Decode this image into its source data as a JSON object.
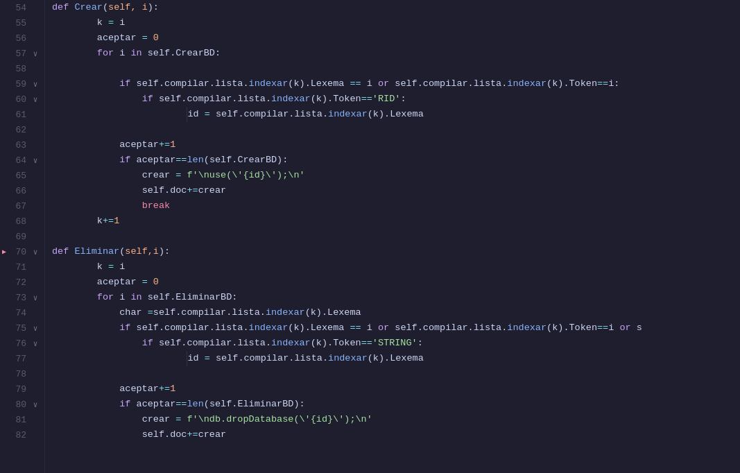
{
  "editor": {
    "background": "#1e1e2e",
    "lines": [
      {
        "num": 54,
        "fold": false,
        "bp": false,
        "indent": 0,
        "tokens": [
          {
            "t": "kw",
            "v": "def "
          },
          {
            "t": "fn",
            "v": "Crear"
          },
          {
            "t": "punct",
            "v": "("
          },
          {
            "t": "param",
            "v": "self, i"
          },
          {
            "t": "punct",
            "v": "):"
          }
        ]
      },
      {
        "num": 55,
        "fold": false,
        "bp": false,
        "indent": 2,
        "tokens": [
          {
            "t": "var",
            "v": "k "
          },
          {
            "t": "eq",
            "v": "="
          },
          {
            "t": "var",
            "v": " i"
          }
        ]
      },
      {
        "num": 56,
        "fold": false,
        "bp": false,
        "indent": 2,
        "tokens": [
          {
            "t": "var",
            "v": "aceptar "
          },
          {
            "t": "eq",
            "v": "="
          },
          {
            "t": "var",
            "v": " "
          },
          {
            "t": "num",
            "v": "0"
          }
        ]
      },
      {
        "num": 57,
        "fold": true,
        "bp": false,
        "indent": 2,
        "tokens": [
          {
            "t": "kw",
            "v": "for "
          },
          {
            "t": "var",
            "v": "i "
          },
          {
            "t": "kw",
            "v": "in "
          },
          {
            "t": "var",
            "v": "self"
          },
          {
            "t": "punct",
            "v": "."
          },
          {
            "t": "attr",
            "v": "CrearBD"
          },
          {
            "t": "punct",
            "v": ":"
          }
        ]
      },
      {
        "num": 58,
        "fold": false,
        "bp": false,
        "indent": 0,
        "tokens": []
      },
      {
        "num": 59,
        "fold": true,
        "bp": false,
        "indent": 3,
        "tokens": [
          {
            "t": "kw",
            "v": "if "
          },
          {
            "t": "var",
            "v": "self"
          },
          {
            "t": "punct",
            "v": "."
          },
          {
            "t": "attr",
            "v": "compilar"
          },
          {
            "t": "punct",
            "v": "."
          },
          {
            "t": "attr",
            "v": "lista"
          },
          {
            "t": "punct",
            "v": "."
          },
          {
            "t": "method",
            "v": "indexar"
          },
          {
            "t": "punct",
            "v": "("
          },
          {
            "t": "var",
            "v": "k"
          },
          {
            "t": "punct",
            "v": ")."
          },
          {
            "t": "attr",
            "v": "Lexema"
          },
          {
            "t": "var",
            "v": " "
          },
          {
            "t": "eq",
            "v": "=="
          },
          {
            "t": "var",
            "v": " i "
          },
          {
            "t": "kw",
            "v": "or "
          },
          {
            "t": "var",
            "v": "self"
          },
          {
            "t": "punct",
            "v": "."
          },
          {
            "t": "attr",
            "v": "compilar"
          },
          {
            "t": "punct",
            "v": "."
          },
          {
            "t": "attr",
            "v": "lista"
          },
          {
            "t": "punct",
            "v": "."
          },
          {
            "t": "method",
            "v": "indexar"
          },
          {
            "t": "punct",
            "v": "("
          },
          {
            "t": "var",
            "v": "k"
          },
          {
            "t": "punct",
            "v": ")."
          },
          {
            "t": "attr",
            "v": "Token"
          },
          {
            "t": "eq",
            "v": "=="
          },
          {
            "t": "var",
            "v": "i"
          },
          {
            "t": "punct",
            "v": ":"
          }
        ]
      },
      {
        "num": 60,
        "fold": true,
        "bp": false,
        "indent": 4,
        "tokens": [
          {
            "t": "kw",
            "v": "if "
          },
          {
            "t": "var",
            "v": "self"
          },
          {
            "t": "punct",
            "v": "."
          },
          {
            "t": "attr",
            "v": "compilar"
          },
          {
            "t": "punct",
            "v": "."
          },
          {
            "t": "attr",
            "v": "lista"
          },
          {
            "t": "punct",
            "v": "."
          },
          {
            "t": "method",
            "v": "indexar"
          },
          {
            "t": "punct",
            "v": "("
          },
          {
            "t": "var",
            "v": "k"
          },
          {
            "t": "punct",
            "v": ")."
          },
          {
            "t": "attr",
            "v": "Token"
          },
          {
            "t": "eq",
            "v": "=="
          },
          {
            "t": "str",
            "v": "'RID'"
          },
          {
            "t": "punct",
            "v": ":"
          }
        ]
      },
      {
        "num": 61,
        "fold": false,
        "bp": false,
        "indent": 6,
        "tokens": [
          {
            "t": "var",
            "v": "id "
          },
          {
            "t": "eq",
            "v": "="
          },
          {
            "t": "var",
            "v": " self"
          },
          {
            "t": "punct",
            "v": "."
          },
          {
            "t": "attr",
            "v": "compilar"
          },
          {
            "t": "punct",
            "v": "."
          },
          {
            "t": "attr",
            "v": "lista"
          },
          {
            "t": "punct",
            "v": "."
          },
          {
            "t": "method",
            "v": "indexar"
          },
          {
            "t": "punct",
            "v": "("
          },
          {
            "t": "var",
            "v": "k"
          },
          {
            "t": "punct",
            "v": ")."
          },
          {
            "t": "attr",
            "v": "Lexema"
          }
        ]
      },
      {
        "num": 62,
        "fold": false,
        "bp": false,
        "indent": 0,
        "tokens": []
      },
      {
        "num": 63,
        "fold": false,
        "bp": false,
        "indent": 3,
        "tokens": [
          {
            "t": "var",
            "v": "aceptar"
          },
          {
            "t": "eq",
            "v": "+="
          },
          {
            "t": "num",
            "v": "1"
          }
        ]
      },
      {
        "num": 64,
        "fold": true,
        "bp": false,
        "indent": 3,
        "tokens": [
          {
            "t": "kw",
            "v": "if "
          },
          {
            "t": "var",
            "v": "aceptar"
          },
          {
            "t": "eq",
            "v": "=="
          },
          {
            "t": "method",
            "v": "len"
          },
          {
            "t": "punct",
            "v": "("
          },
          {
            "t": "var",
            "v": "self"
          },
          {
            "t": "punct",
            "v": "."
          },
          {
            "t": "attr",
            "v": "CrearBD"
          },
          {
            "t": "punct",
            "v": "):"
          }
        ]
      },
      {
        "num": 65,
        "fold": false,
        "bp": false,
        "indent": 4,
        "tokens": [
          {
            "t": "var",
            "v": "crear "
          },
          {
            "t": "eq",
            "v": "="
          },
          {
            "t": "var",
            "v": " "
          },
          {
            "t": "fstr",
            "v": "f'\\nuse(\\'{id}\\');\\n'"
          }
        ]
      },
      {
        "num": 66,
        "fold": false,
        "bp": false,
        "indent": 4,
        "tokens": [
          {
            "t": "var",
            "v": "self"
          },
          {
            "t": "punct",
            "v": "."
          },
          {
            "t": "attr",
            "v": "doc"
          },
          {
            "t": "eq",
            "v": "+="
          },
          {
            "t": "var",
            "v": "crear"
          }
        ]
      },
      {
        "num": 67,
        "fold": false,
        "bp": false,
        "indent": 4,
        "tokens": [
          {
            "t": "special",
            "v": "break"
          }
        ]
      },
      {
        "num": 68,
        "fold": false,
        "bp": false,
        "indent": 2,
        "tokens": [
          {
            "t": "var",
            "v": "k"
          },
          {
            "t": "eq",
            "v": "+="
          },
          {
            "t": "num",
            "v": "1"
          }
        ]
      },
      {
        "num": 69,
        "fold": false,
        "bp": false,
        "indent": 0,
        "tokens": []
      },
      {
        "num": 70,
        "fold": true,
        "bp": true,
        "indent": 0,
        "tokens": [
          {
            "t": "kw",
            "v": "def "
          },
          {
            "t": "fn",
            "v": "Eliminar"
          },
          {
            "t": "punct",
            "v": "("
          },
          {
            "t": "param",
            "v": "self,i"
          },
          {
            "t": "punct",
            "v": "):"
          }
        ]
      },
      {
        "num": 71,
        "fold": false,
        "bp": false,
        "indent": 2,
        "tokens": [
          {
            "t": "var",
            "v": "k "
          },
          {
            "t": "eq",
            "v": "="
          },
          {
            "t": "var",
            "v": " i"
          }
        ]
      },
      {
        "num": 72,
        "fold": false,
        "bp": false,
        "indent": 2,
        "tokens": [
          {
            "t": "var",
            "v": "aceptar "
          },
          {
            "t": "eq",
            "v": "="
          },
          {
            "t": "var",
            "v": " "
          },
          {
            "t": "num",
            "v": "0"
          }
        ]
      },
      {
        "num": 73,
        "fold": true,
        "bp": false,
        "indent": 2,
        "tokens": [
          {
            "t": "kw",
            "v": "for "
          },
          {
            "t": "var",
            "v": "i "
          },
          {
            "t": "kw",
            "v": "in "
          },
          {
            "t": "var",
            "v": "self"
          },
          {
            "t": "punct",
            "v": "."
          },
          {
            "t": "attr",
            "v": "EliminarBD"
          },
          {
            "t": "punct",
            "v": ":"
          }
        ]
      },
      {
        "num": 74,
        "fold": false,
        "bp": false,
        "indent": 3,
        "tokens": [
          {
            "t": "var",
            "v": "char "
          },
          {
            "t": "eq",
            "v": "="
          },
          {
            "t": "var",
            "v": "self"
          },
          {
            "t": "punct",
            "v": "."
          },
          {
            "t": "attr",
            "v": "compilar"
          },
          {
            "t": "punct",
            "v": "."
          },
          {
            "t": "attr",
            "v": "lista"
          },
          {
            "t": "punct",
            "v": "."
          },
          {
            "t": "method",
            "v": "indexar"
          },
          {
            "t": "punct",
            "v": "("
          },
          {
            "t": "var",
            "v": "k"
          },
          {
            "t": "punct",
            "v": ")."
          },
          {
            "t": "attr",
            "v": "Lexema"
          }
        ]
      },
      {
        "num": 75,
        "fold": true,
        "bp": false,
        "indent": 3,
        "tokens": [
          {
            "t": "kw",
            "v": "if "
          },
          {
            "t": "var",
            "v": "self"
          },
          {
            "t": "punct",
            "v": "."
          },
          {
            "t": "attr",
            "v": "compilar"
          },
          {
            "t": "punct",
            "v": "."
          },
          {
            "t": "attr",
            "v": "lista"
          },
          {
            "t": "punct",
            "v": "."
          },
          {
            "t": "method",
            "v": "indexar"
          },
          {
            "t": "punct",
            "v": "("
          },
          {
            "t": "var",
            "v": "k"
          },
          {
            "t": "punct",
            "v": ")."
          },
          {
            "t": "attr",
            "v": "Lexema"
          },
          {
            "t": "var",
            "v": " "
          },
          {
            "t": "eq",
            "v": "=="
          },
          {
            "t": "var",
            "v": " i "
          },
          {
            "t": "kw",
            "v": "or "
          },
          {
            "t": "var",
            "v": "self"
          },
          {
            "t": "punct",
            "v": "."
          },
          {
            "t": "attr",
            "v": "compilar"
          },
          {
            "t": "punct",
            "v": "."
          },
          {
            "t": "attr",
            "v": "lista"
          },
          {
            "t": "punct",
            "v": "."
          },
          {
            "t": "method",
            "v": "indexar"
          },
          {
            "t": "punct",
            "v": "("
          },
          {
            "t": "var",
            "v": "k"
          },
          {
            "t": "punct",
            "v": ")."
          },
          {
            "t": "attr",
            "v": "Token"
          },
          {
            "t": "eq",
            "v": "=="
          },
          {
            "t": "var",
            "v": "i "
          },
          {
            "t": "kw",
            "v": "or "
          },
          {
            "t": "var",
            "v": "s"
          }
        ]
      },
      {
        "num": 76,
        "fold": true,
        "bp": false,
        "indent": 4,
        "tokens": [
          {
            "t": "kw",
            "v": "if "
          },
          {
            "t": "var",
            "v": "self"
          },
          {
            "t": "punct",
            "v": "."
          },
          {
            "t": "attr",
            "v": "compilar"
          },
          {
            "t": "punct",
            "v": "."
          },
          {
            "t": "attr",
            "v": "lista"
          },
          {
            "t": "punct",
            "v": "."
          },
          {
            "t": "method",
            "v": "indexar"
          },
          {
            "t": "punct",
            "v": "("
          },
          {
            "t": "var",
            "v": "k"
          },
          {
            "t": "punct",
            "v": ")."
          },
          {
            "t": "attr",
            "v": "Token"
          },
          {
            "t": "eq",
            "v": "=="
          },
          {
            "t": "str",
            "v": "'STRING'"
          },
          {
            "t": "punct",
            "v": ":"
          }
        ]
      },
      {
        "num": 77,
        "fold": false,
        "bp": false,
        "indent": 6,
        "tokens": [
          {
            "t": "var",
            "v": "id "
          },
          {
            "t": "eq",
            "v": "="
          },
          {
            "t": "var",
            "v": " self"
          },
          {
            "t": "punct",
            "v": "."
          },
          {
            "t": "attr",
            "v": "compilar"
          },
          {
            "t": "punct",
            "v": "."
          },
          {
            "t": "attr",
            "v": "lista"
          },
          {
            "t": "punct",
            "v": "."
          },
          {
            "t": "method",
            "v": "indexar"
          },
          {
            "t": "punct",
            "v": "("
          },
          {
            "t": "var",
            "v": "k"
          },
          {
            "t": "punct",
            "v": ")."
          },
          {
            "t": "attr",
            "v": "Lexema"
          }
        ]
      },
      {
        "num": 78,
        "fold": false,
        "bp": false,
        "indent": 0,
        "tokens": []
      },
      {
        "num": 79,
        "fold": false,
        "bp": false,
        "indent": 3,
        "tokens": [
          {
            "t": "var",
            "v": "aceptar"
          },
          {
            "t": "eq",
            "v": "+="
          },
          {
            "t": "num",
            "v": "1"
          }
        ]
      },
      {
        "num": 80,
        "fold": true,
        "bp": false,
        "indent": 3,
        "tokens": [
          {
            "t": "kw",
            "v": "if "
          },
          {
            "t": "var",
            "v": "aceptar"
          },
          {
            "t": "eq",
            "v": "=="
          },
          {
            "t": "method",
            "v": "len"
          },
          {
            "t": "punct",
            "v": "("
          },
          {
            "t": "var",
            "v": "self"
          },
          {
            "t": "punct",
            "v": "."
          },
          {
            "t": "attr",
            "v": "EliminarBD"
          },
          {
            "t": "punct",
            "v": "):"
          }
        ]
      },
      {
        "num": 81,
        "fold": false,
        "bp": false,
        "indent": 4,
        "tokens": [
          {
            "t": "var",
            "v": "crear "
          },
          {
            "t": "eq",
            "v": "="
          },
          {
            "t": "var",
            "v": " "
          },
          {
            "t": "fstr",
            "v": "f'\\ndb.dropDatabase(\\'{id}\\');\\n'"
          }
        ]
      },
      {
        "num": 82,
        "fold": false,
        "bp": false,
        "indent": 4,
        "tokens": [
          {
            "t": "var",
            "v": "self"
          },
          {
            "t": "punct",
            "v": "."
          },
          {
            "t": "attr",
            "v": "doc"
          },
          {
            "t": "eq",
            "v": "+="
          },
          {
            "t": "var",
            "v": "crear"
          }
        ]
      }
    ]
  }
}
